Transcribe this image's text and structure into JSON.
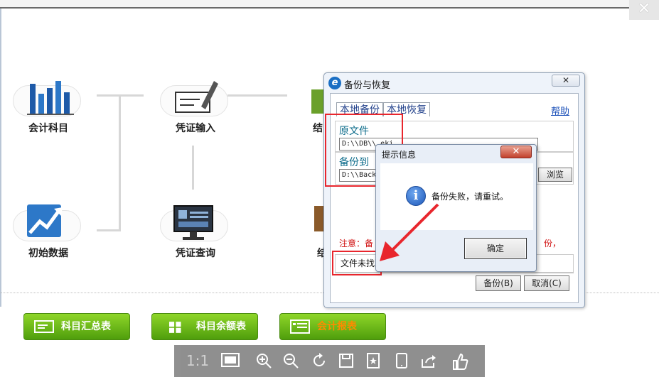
{
  "window": {
    "close_glyph": "✕"
  },
  "tiles": [
    {
      "label": "会计科目",
      "icon": "bar-chart-icon"
    },
    {
      "label": "凭证输入",
      "icon": "voucher-pen-icon"
    },
    {
      "label": "结",
      "icon": "book-icon"
    },
    {
      "label": "初始数据",
      "icon": "trend-up-icon"
    },
    {
      "label": "凭证查询",
      "icon": "monitor-icon"
    },
    {
      "label": "结",
      "icon": "folder-icon"
    }
  ],
  "buttons": {
    "subject_summary": "科目汇总表",
    "subject_balance": "科目余额表",
    "accounting_report": "会计报表"
  },
  "viewer": {
    "ratio_label": "1:1"
  },
  "backup_dialog": {
    "title": "备份与恢复",
    "close_glyph": "✕",
    "tabs": [
      "本地备份",
      "本地恢复"
    ],
    "help": "帮助",
    "source_label": "原文件",
    "source_path": "D:\\\\DB\\\\.eki",
    "target_label": "备份到",
    "target_path": "D:\\\\Back",
    "browse": "浏览",
    "note_prefix": "注意：备",
    "note_suffix": "份，",
    "status": "文件未找到",
    "backup_button": "备份(B)",
    "cancel_button": "取消(C)"
  },
  "message_box": {
    "title": "提示信息",
    "close_glyph": "✕",
    "info_glyph": "i",
    "message": "备份失败，请重试。",
    "ok": "确定"
  },
  "colors": {
    "accent_green": "#5aaa14",
    "annotation_red": "#e8262d",
    "dialog_blue": "#1b6fc4"
  }
}
